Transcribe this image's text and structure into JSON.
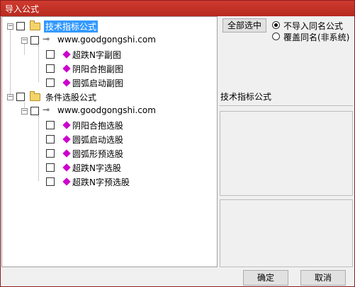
{
  "window": {
    "title": "导入公式"
  },
  "tree": {
    "groups": [
      {
        "label": "技术指标公式",
        "site": "www.goodgongshi.com",
        "items": [
          "超跌N字副图",
          "阴阳合抱副图",
          "圆弧启动副图"
        ]
      },
      {
        "label": "条件选股公式",
        "site": "www.goodgongshi.com",
        "items": [
          "阴阳合抱选股",
          "圆弧启动选股",
          "圆弧形预选股",
          "超跌N字选股",
          "超跌N字预选股"
        ]
      }
    ]
  },
  "options": {
    "select_all_label": "全部选中",
    "radio_skip_label": "不导入同名公式",
    "radio_overwrite_label": "覆盖同名(非系统)",
    "radio_selected": "skip"
  },
  "info": {
    "section_title": "技术指标公式"
  },
  "buttons": {
    "ok_label": "确定",
    "cancel_label": "取消"
  },
  "colors": {
    "title_bar": "#c0392b",
    "selection": "#3399ff",
    "formula_icon": "#cc00cc"
  }
}
